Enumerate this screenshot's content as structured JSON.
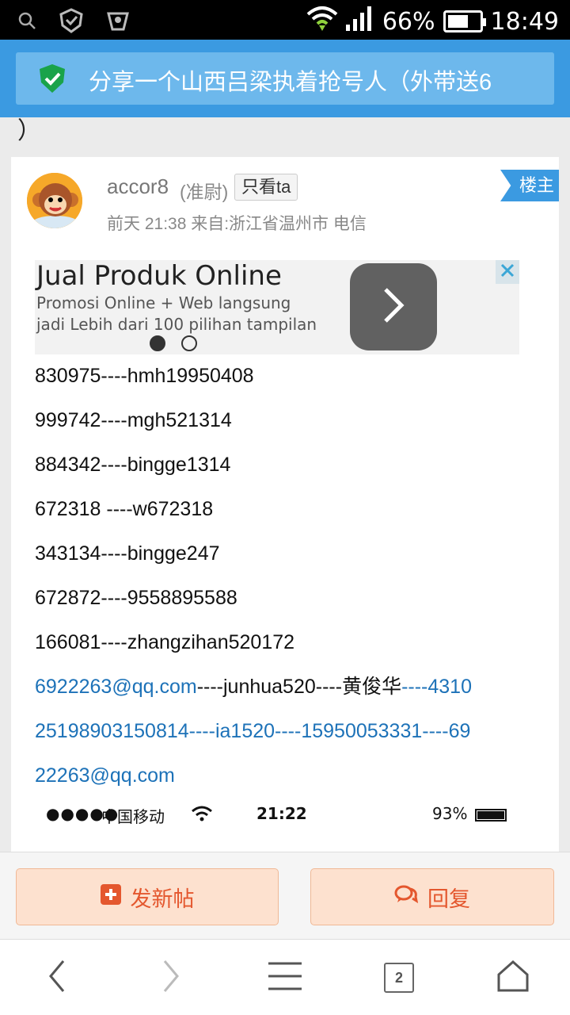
{
  "status_bar": {
    "battery_text": "66%",
    "battery_level": 0.66,
    "time": "18:49",
    "icons": [
      "search-icon",
      "shield-check-icon",
      "fan-icon",
      "wifi-icon",
      "signal-icon",
      "battery-icon"
    ]
  },
  "header": {
    "title": "分享一个山西吕梁执着抢号人（外带送6",
    "title_overflow": "）",
    "accent_color": "#3b9ae1"
  },
  "post": {
    "username": "accor8",
    "rank": "(准尉)",
    "only_ta_label": "只看ta",
    "op_badge": "楼主",
    "meta": "前天 21:38 来自:浙江省温州市 电信"
  },
  "ad": {
    "title": "Jual Produk Online",
    "line1": "Promosi Online + Web langsung",
    "line2": "jadi Lebih dari 100 pilihan tampilan"
  },
  "content": {
    "line1": "830975----hmh19950408",
    "line2": "999742----mgh521314",
    "line3": "884342----bingge1314",
    "line4": "672318 ----w672318",
    "line5": "343134----bingge247",
    "line6": "672872----9558895588",
    "line7": "166081----zhangzihan520172",
    "line8_link": "6922263@qq.com",
    "line8_text": "----junhua520----黄俊华",
    "line8_link2": "----4310",
    "line9": "25198903150814----ia1520----15950053331----69",
    "line10": "22263@qq.com"
  },
  "embedded_screenshot": {
    "signal": "●●●●●",
    "carrier": "中国移动",
    "time": "21:22",
    "battery": "93%"
  },
  "actions": {
    "new_post_label": "发新帖",
    "reply_label": "回复"
  },
  "navbar": {
    "tab_count": "2"
  }
}
